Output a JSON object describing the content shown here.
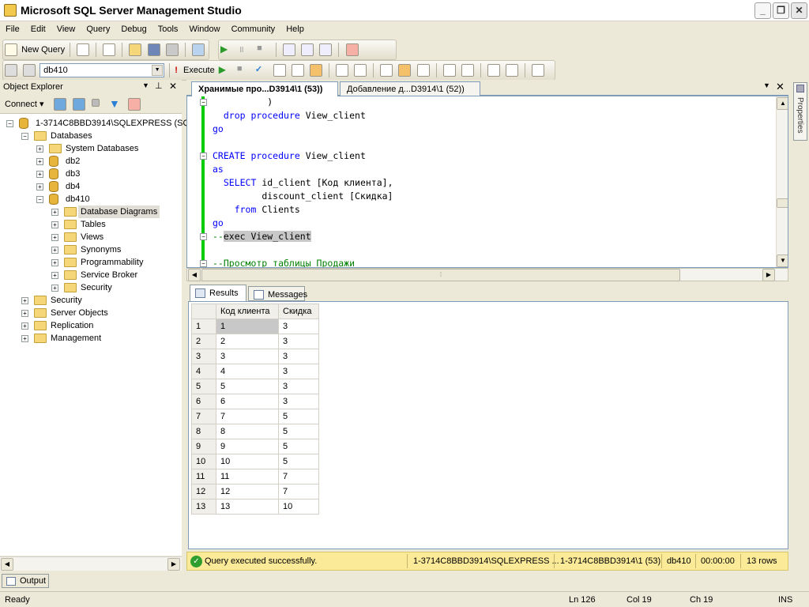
{
  "window": {
    "title": "Microsoft SQL Server Management Studio"
  },
  "menu": [
    "File",
    "Edit",
    "View",
    "Query",
    "Debug",
    "Tools",
    "Window",
    "Community",
    "Help"
  ],
  "toolbar": {
    "new_query": "New Query",
    "database": "db410",
    "execute": "Execute"
  },
  "object_explorer": {
    "title": "Object Explorer",
    "connect": "Connect",
    "tree": [
      {
        "label": "1-3714C8BBD3914\\SQLEXPRESS (SQL",
        "level": 0,
        "icon": "server-icon",
        "expanded": true
      },
      {
        "label": "Databases",
        "level": 1,
        "icon": "folder-icon",
        "expanded": true
      },
      {
        "label": "System Databases",
        "level": 2,
        "icon": "folder-icon",
        "expanded": false
      },
      {
        "label": "db2",
        "level": 2,
        "icon": "database-icon",
        "expanded": false
      },
      {
        "label": "db3",
        "level": 2,
        "icon": "database-icon",
        "expanded": false
      },
      {
        "label": "db4",
        "level": 2,
        "icon": "database-icon",
        "expanded": false
      },
      {
        "label": "db410",
        "level": 2,
        "icon": "database-icon",
        "expanded": true
      },
      {
        "label": "Database Diagrams",
        "level": 3,
        "icon": "folder-icon",
        "expanded": false,
        "selected": true
      },
      {
        "label": "Tables",
        "level": 3,
        "icon": "folder-icon",
        "expanded": false
      },
      {
        "label": "Views",
        "level": 3,
        "icon": "folder-icon",
        "expanded": false
      },
      {
        "label": "Synonyms",
        "level": 3,
        "icon": "folder-icon",
        "expanded": false
      },
      {
        "label": "Programmability",
        "level": 3,
        "icon": "folder-icon",
        "expanded": false
      },
      {
        "label": "Service Broker",
        "level": 3,
        "icon": "folder-icon",
        "expanded": false
      },
      {
        "label": "Security",
        "level": 3,
        "icon": "folder-icon",
        "expanded": false
      },
      {
        "label": "Security",
        "level": 1,
        "icon": "folder-icon",
        "expanded": false
      },
      {
        "label": "Server Objects",
        "level": 1,
        "icon": "folder-icon",
        "expanded": false
      },
      {
        "label": "Replication",
        "level": 1,
        "icon": "folder-icon",
        "expanded": false
      },
      {
        "label": "Management",
        "level": 1,
        "icon": "folder-icon",
        "expanded": false
      }
    ]
  },
  "doc_tabs": [
    "Хранимые про...D3914\\1 (53))",
    "Добавление д...D3914\\1 (52))"
  ],
  "code_lines": [
    {
      "indent": "          ",
      "parts": [
        {
          "t": ")",
          "c": ""
        }
      ]
    },
    {
      "indent": "  ",
      "parts": [
        {
          "t": "drop procedure",
          "c": "kw"
        },
        {
          "t": " View_client",
          "c": ""
        }
      ]
    },
    {
      "indent": "",
      "parts": [
        {
          "t": "go",
          "c": "kw"
        }
      ]
    },
    {
      "indent": "",
      "parts": []
    },
    {
      "indent": "",
      "parts": [
        {
          "t": "CREATE procedure",
          "c": "kw"
        },
        {
          "t": " View_client",
          "c": ""
        }
      ]
    },
    {
      "indent": "",
      "parts": [
        {
          "t": "as",
          "c": "kw"
        }
      ]
    },
    {
      "indent": "  ",
      "parts": [
        {
          "t": "SELECT",
          "c": "kw"
        },
        {
          "t": " id_client [Код клиента],",
          "c": ""
        }
      ]
    },
    {
      "indent": "         ",
      "parts": [
        {
          "t": "discount_client [Скидка]",
          "c": ""
        }
      ]
    },
    {
      "indent": "    ",
      "parts": [
        {
          "t": "from",
          "c": "kw"
        },
        {
          "t": " Clients",
          "c": ""
        }
      ]
    },
    {
      "indent": "",
      "parts": [
        {
          "t": "go",
          "c": "kw"
        }
      ]
    },
    {
      "indent": "",
      "parts": [
        {
          "t": "--",
          "c": "cm"
        },
        {
          "t": "exec View_client",
          "c": "sel"
        }
      ]
    },
    {
      "indent": "",
      "parts": []
    },
    {
      "indent": "",
      "parts": [
        {
          "t": "--Просмотр таблицы Продажи",
          "c": "cm"
        }
      ]
    }
  ],
  "results_tabs": {
    "results": "Results",
    "messages": "Messages"
  },
  "grid": {
    "columns": [
      "Код клиента",
      "Скидка"
    ],
    "rows": [
      [
        "1",
        "1",
        "3"
      ],
      [
        "2",
        "2",
        "3"
      ],
      [
        "3",
        "3",
        "3"
      ],
      [
        "4",
        "4",
        "3"
      ],
      [
        "5",
        "5",
        "3"
      ],
      [
        "6",
        "6",
        "3"
      ],
      [
        "7",
        "7",
        "5"
      ],
      [
        "8",
        "8",
        "5"
      ],
      [
        "9",
        "9",
        "5"
      ],
      [
        "10",
        "10",
        "5"
      ],
      [
        "11",
        "11",
        "7"
      ],
      [
        "12",
        "12",
        "7"
      ],
      [
        "13",
        "13",
        "10"
      ]
    ]
  },
  "query_status": {
    "message": "Query executed successfully.",
    "server": "1-3714C8BBD3914\\SQLEXPRESS ...",
    "connection": "1-3714C8BBD3914\\1 (53)",
    "database": "db410",
    "elapsed": "00:00:00",
    "rows": "13 rows"
  },
  "output_tab": "Output",
  "status": {
    "ready": "Ready",
    "ln": "Ln 126",
    "col": "Col 19",
    "ch": "Ch 19",
    "ins": "INS"
  },
  "properties_label": "Properties"
}
